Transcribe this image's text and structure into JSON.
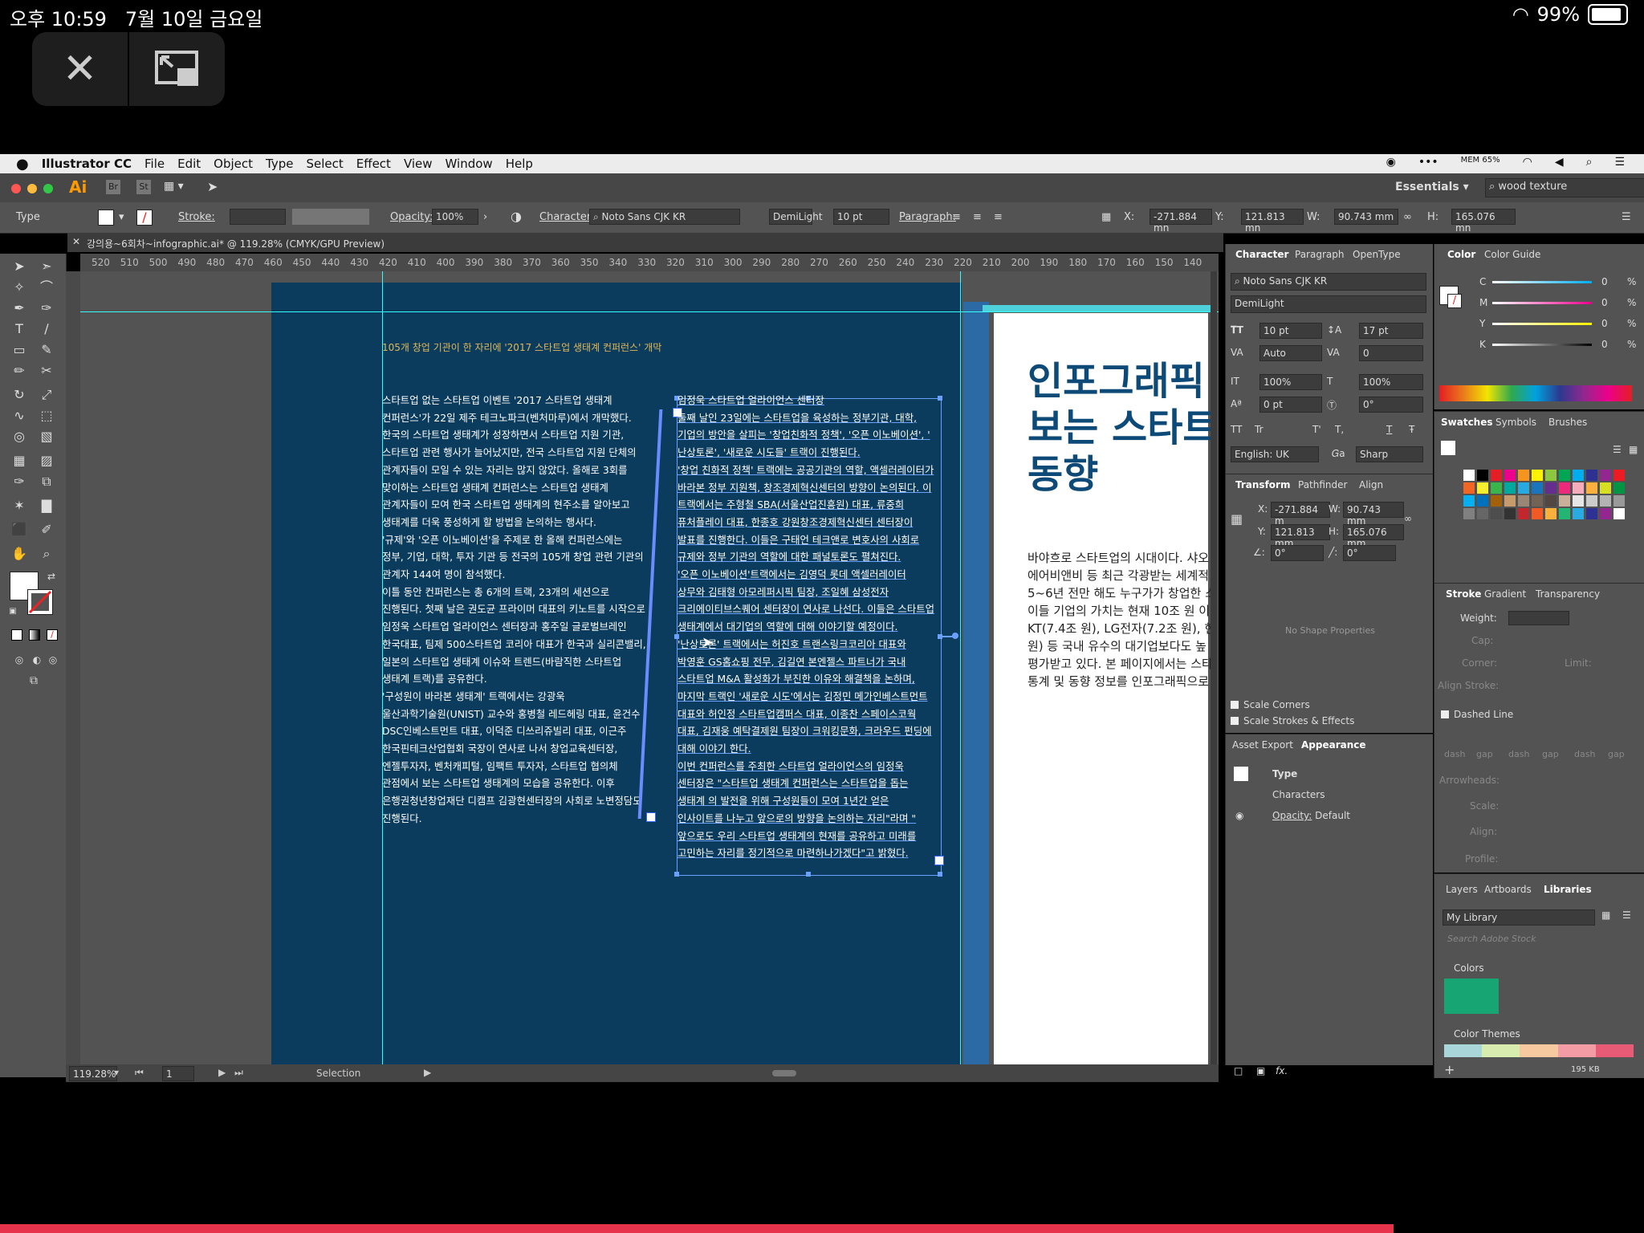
{
  "ipad_status": {
    "time": "오후 10:59",
    "date": "7월 10일 금요일",
    "battery": "99%"
  },
  "pip": {
    "close_icon": "close-icon",
    "minimize_icon": "pip-icon"
  },
  "menubar": {
    "app": "Illustrator CC",
    "items": [
      "File",
      "Edit",
      "Object",
      "Type",
      "Select",
      "Effect",
      "View",
      "Window",
      "Help"
    ],
    "mem": "MEM 65%"
  },
  "appbar": {
    "logo": "Ai",
    "bridge": "Br",
    "stock": "St",
    "workspace": "Essentials",
    "search_value": "wood texture"
  },
  "control": {
    "type_label": "Type",
    "stroke_label": "Stroke:",
    "opacity_label": "Opacity:",
    "opacity_value": "100%",
    "character_label": "Character:",
    "font": "Noto Sans CJK KR",
    "weight": "DemiLight",
    "size": "10 pt",
    "paragraph_label": "Paragraph:",
    "x_label": "X:",
    "x_value": "-271.884 mn",
    "y_label": "Y:",
    "y_value": "121.813 mn",
    "w_label": "W:",
    "w_value": "90.743 mm",
    "h_label": "H:",
    "h_value": "165.076 mn"
  },
  "doc_tab": {
    "title": "강의용~6회차~infographic.ai* @ 119.28% (CMYK/GPU Preview)"
  },
  "ruler_ticks": [
    "520",
    "510",
    "500",
    "490",
    "480",
    "470",
    "460",
    "450",
    "440",
    "430",
    "420",
    "410",
    "400",
    "390",
    "380",
    "370",
    "360",
    "350",
    "340",
    "330",
    "320",
    "310",
    "300",
    "290",
    "280",
    "270",
    "260",
    "250",
    "240",
    "230",
    "220",
    "210",
    "200",
    "190",
    "180",
    "170",
    "160",
    "150",
    "140"
  ],
  "artboard": {
    "headline": "105개 창업 기관이 한 자리에 '2017 스타트업 생태계 컨퍼런스' 개막",
    "col1": [
      "스타트업 없는 스타트업 이벤트 '2017 스타트업 생태계",
      "컨퍼런스'가 22일 제주 테크노파크(벤처마루)에서 개막했다.",
      "한국의 스타트업 생태계가 성장하면서 스타트업 지원 기관,",
      "스타트업 관련 행사가 늘어났지만, 전국 스타트업 지원 단체의",
      "관계자들이 모일 수 있는 자리는 많지 않았다. 올해로 3회를",
      "맞이하는 스타트업 생태계 컨퍼런스는 스타트업 생태계",
      "관계자들이 모여 한국 스타트업 생태계의 현주소를 알아보고",
      "생태계를 더욱 풍성하게 할 방법을 논의하는 행사다.",
      "'규제'와 '오픈 이노베이션'을 주제로 한 올해 컨퍼런스에는",
      "정부, 기업, 대학, 투자 기관 등 전국의 105개 창업 관련 기관의",
      "관계자 144여 명이 참석했다.",
      "이틀 동안 컨퍼런스는 총 6개의 트랙, 23개의 세션으로",
      "진행된다. 첫째 날은 권도균 프라이머 대표의 키노트를 시작으로",
      "임정욱 스타트업 얼라이언스 센터장과 홍주일 글로벌브레인",
      "한국대표, 팀제 500스타트업 코리아 대표가 한국과 실리콘밸리,",
      "일본의 스타트업 생태계 이슈와 트렌드(바람직한 스타트업",
      "생태계 트랙)를 공유한다.",
      "'구성원이 바라본 생태계' 트랙에서는 강광욱",
      "울산과학기술원(UNIST) 교수와 홍병철 레드헤링 대표, 윤건수",
      "DSC인베스트먼트 대표, 이덕준 디쓰리쥬빌리 대표, 이근주",
      "한국핀테크산업협회 국장이 연사로 나서 창업교육센터장,",
      "엔젤투자자, 벤처캐피털, 임팩트 투자자, 스타트업 협의체",
      "관점에서 보는 스타트업 생태계의 모습을 공유한다. 이후",
      "은행권청년창업재단 디캠프 김광현센터장의 사회로 노변정담도",
      "진행된다."
    ],
    "col2": [
      "임정욱 스타트업 얼라이언스 센터장",
      "둘째 날인 23일에는 스타트업을 육성하는 정부기관, 대학,",
      "기업의 방안을 살피는 '창업친화적 정책', '오픈 이노베이션', '",
      "난상토론', '새로운 시도들' 트랙이 진행된다.",
      "'창업 친화적 정책' 트랙에는 공공기관의 역할, 액셀러레이터가",
      "바라본 정부 지원책, 창조경제혁신센터의 방향이 논의된다. 이",
      "트랙에서는 주형철 SBA(서울산업진흥원) 대표, 류중희",
      "퓨처플레이 대표, 한종호 강원창조경제혁신센터 센터장이",
      "발표를 진행한다. 이들은 구태언 테크앤로 변호사의 사회로",
      "규제와 정부 기관의 역할에 대한 패널토론도 펼쳐진다.",
      "'오픈 이노베이션'트랙에서는 김영덕 롯데 액셀러레이터",
      "상무와 김태형 아모레퍼시픽 팀장, 조일혜 삼성전자",
      "크리에이티브스퀘어 센터장이 연사로 나선다. 이들은 스타트업",
      "생태계에서 대기업의 역할에 대해 이야기할 예정이다.",
      "'난상토론' 트랙에서는 허진호 트랜스링크코리아 대표와",
      "박영훈 GS홈쇼핑 전무, 김길연 본엔젤스 파트너가 국내",
      "스타트업 M&A 활성화가 부진한 이유와 해결책을 논하며,",
      "마지막 트랙인 '새로운 시도'에서는 김정민 메가인베스트먼트",
      "대표와 허인정 스타트업캠퍼스 대표, 이종찬 스페이스코웍",
      "대표, 김재웅 예탁결제원 팀장이 크워킹문화, 크라우드 펀딩에",
      "대해 이야기 한다.",
      "이번 컨퍼런스를 주최한 스타트업 얼라이언스의 임정욱",
      "센터장은 \"스타트업 생태계 컨퍼런스는 스타트업을 돕는",
      "생태계 의 발전을 위해 구성원들이 모여 1년간 얻은",
      "인사이트를 나누고 앞으로의 방향을 논의하는 자리\"라며 \"",
      "앞으로도 우리 스타트업 생태계의 현재를 공유하고 미래를",
      "고민하는 자리를 정기적으로 마련하나가겠다\"고 밝혔다."
    ]
  },
  "page2": {
    "title": [
      "인포그래픽",
      "보는 스타트",
      "동향"
    ],
    "body": [
      "바야흐로 스타트업의 시대이다. 샤오",
      "에어비앤비 등 최근 각광받는 세계적",
      "5~6년 전만 해도 누구가가 창업한 스",
      "이들 기업의 가치는 현재 10조 원 이",
      "KT(7.4조 원), LG전자(7.2조 원), 현",
      "원) 등 국내 유수의 대기업보다도 높",
      "평가받고 있다. 본 페이지에서는 스타",
      "통계 및 동향 정보를 인포그래픽으로"
    ]
  },
  "statusbar": {
    "zoom": "119.28%",
    "page": "1",
    "tool": "Selection"
  },
  "character_panel": {
    "tabs": [
      "Character",
      "Paragraph",
      "OpenType"
    ],
    "font": "Noto Sans CJK KR",
    "weight": "DemiLight",
    "size": "10 pt",
    "leading": "17 pt",
    "kerning": "Auto",
    "tracking": "0",
    "vscale": "100%",
    "hscale": "100%",
    "baseline": "0 pt",
    "rotation": "0°",
    "caps": [
      "TT",
      "Tr",
      "T'",
      "T,",
      "T",
      "Ŧ"
    ],
    "language": "English: UK",
    "aa_label": "a",
    "antialias": "Sharp"
  },
  "transform_panel": {
    "tabs": [
      "Transform",
      "Pathfinder",
      "Align"
    ],
    "x": "-271.884 m",
    "y": "121.813 mm",
    "w": "90.743 mm",
    "h": "165.076 mm",
    "angle": "0°",
    "shear": "0°",
    "no_shape": "No Shape Properties",
    "scale_corners": "Scale Corners",
    "scale_strokes": "Scale Strokes & Effects"
  },
  "appearance_panel": {
    "tabs": [
      "Asset Export",
      "Appearance"
    ],
    "type_row": "Type",
    "characters_row": "Characters",
    "opacity_row": "Opacity:",
    "opacity_value": "Default"
  },
  "color_panel": {
    "tabs": [
      "Color",
      "Color Guide"
    ],
    "channels": [
      {
        "name": "C",
        "value": "0"
      },
      {
        "name": "M",
        "value": "0"
      },
      {
        "name": "Y",
        "value": "0"
      },
      {
        "name": "K",
        "value": "0"
      }
    ],
    "percent": "%"
  },
  "swatches_panel": {
    "tabs": [
      "Swatches",
      "Symbols",
      "Brushes"
    ]
  },
  "stroke_panel": {
    "tabs": [
      "Stroke",
      "Gradient",
      "Transparency"
    ],
    "weight_label": "Weight:",
    "cap_label": "Cap:",
    "corner_label": "Corner:",
    "limit_label": "Limit:",
    "align_label": "Align Stroke:",
    "dashed_label": "Dashed Line",
    "dash_labels": [
      "dash",
      "gap",
      "dash",
      "gap",
      "dash",
      "gap"
    ],
    "arrowheads_label": "Arrowheads:",
    "scale_label": "Scale:",
    "align2_label": "Align:",
    "profile_label": "Profile:"
  },
  "libraries_panel": {
    "tabs": [
      "Layers",
      "Artboards",
      "Libraries"
    ],
    "library": "My Library",
    "search_placeholder": "Search Adobe Stock",
    "colors_label": "Colors",
    "themes_label": "Color Themes",
    "size": "195 KB",
    "green": "#17a673",
    "theme_colors": [
      "#a9d6d9",
      "#d9ecb0",
      "#f7c9a0",
      "#f39ca6",
      "#e85b76"
    ]
  }
}
